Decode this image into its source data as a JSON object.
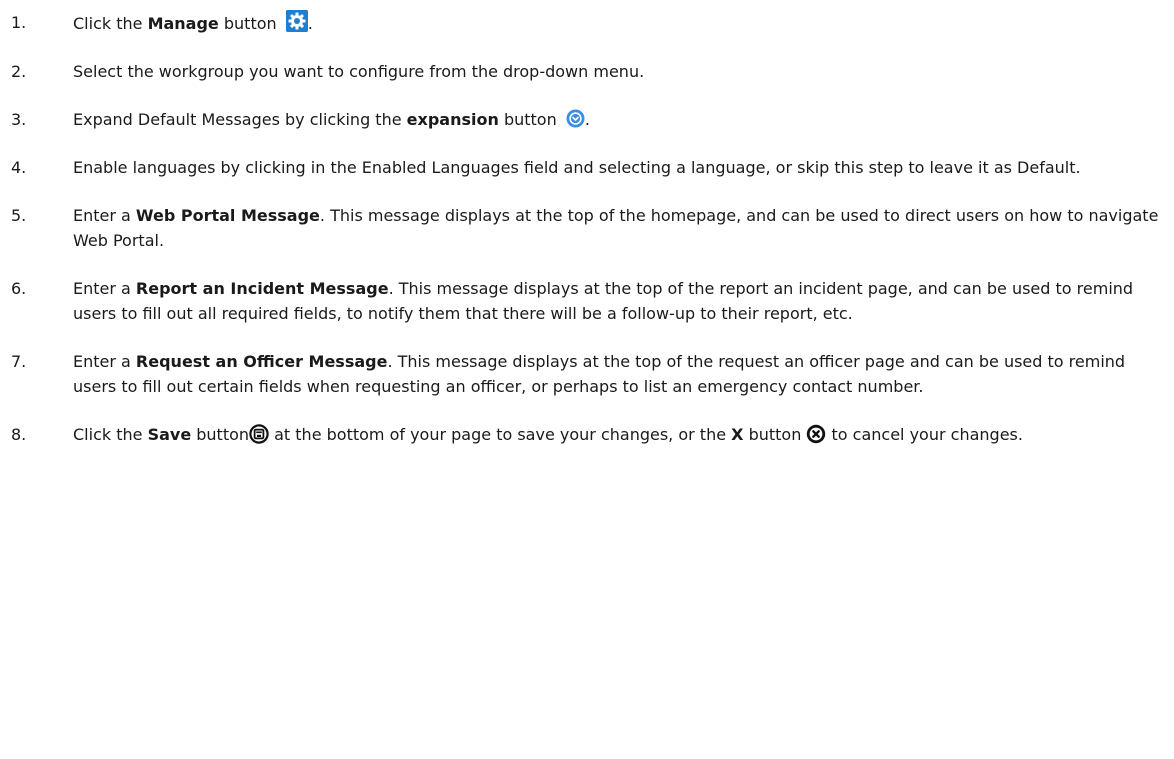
{
  "steps": [
    {
      "number": "1.",
      "text_a": "Click the ",
      "bold_a": "Manage",
      "text_b": " button",
      "text_c": "."
    },
    {
      "number": "2.",
      "text_a": "Select the workgroup you want to configure from the drop-down menu."
    },
    {
      "number": "3.",
      "text_a": "Expand Default Messages by clicking the ",
      "bold_a": "expansion",
      "text_b": " button",
      "text_c": "."
    },
    {
      "number": "4.",
      "text_a": "Enable languages by clicking in the Enabled Languages field and selecting a language, or skip this step to leave it as Default."
    },
    {
      "number": "5.",
      "text_a": "Enter a ",
      "bold_a": "Web Portal Message",
      "text_b": ". This message displays at the top of the homepage, and can be used to direct users on how to navigate Web Portal."
    },
    {
      "number": "6.",
      "text_a": "Enter a ",
      "bold_a": "Report an Incident Message",
      "text_b": ". This message displays at the top of the report an incident page, and can be used to remind users to fill out all required fields, to notify them that there will be a follow-up to their report, etc."
    },
    {
      "number": "7.",
      "text_a": "Enter a ",
      "bold_a": "Request an Officer Message",
      "text_b": ". This message displays at the top of the request an officer page and can be used to remind users to fill out certain fields when requesting an officer, or perhaps to list an emergency contact number."
    },
    {
      "number": "8.",
      "text_a": "Click the ",
      "bold_a": "Save",
      "text_b": " button",
      "text_c": " at the bottom of your page to save your changes, or the ",
      "bold_b": "X",
      "text_d": " button ",
      "text_e": " to cancel your changes."
    }
  ],
  "icons": {
    "manage": "gear-icon",
    "expansion": "chevron-down-circle-icon",
    "save": "save-circle-icon",
    "cancel": "close-circle-icon"
  },
  "colors": {
    "text": "#1a1a1a",
    "manage_button": "#1e7fd0",
    "expansion_button": "#3a8ee6",
    "save_cancel_icons": "#111111"
  }
}
